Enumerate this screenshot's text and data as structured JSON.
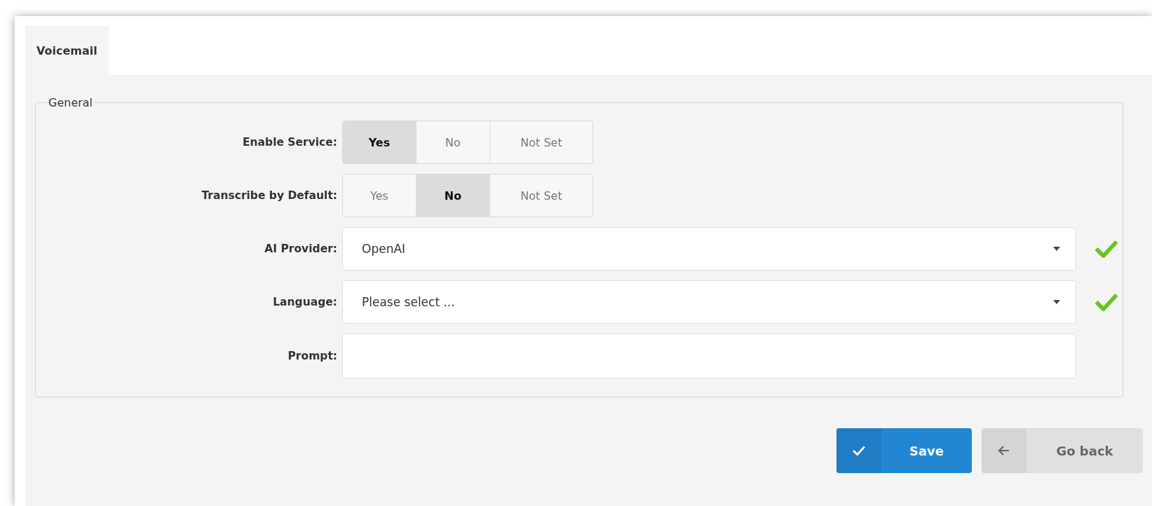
{
  "tabs": [
    {
      "label": "Voicemail",
      "selected": true
    }
  ],
  "fieldset": {
    "legend": "General",
    "fields": [
      {
        "kind": "segmented",
        "label": "Enable Service:",
        "options": [
          {
            "label": "Yes",
            "selected": true
          },
          {
            "label": "No",
            "selected": false
          },
          {
            "label": "Not Set",
            "selected": false
          }
        ]
      },
      {
        "kind": "segmented",
        "label": "Transcribe by Default:",
        "options": [
          {
            "label": "Yes",
            "selected": false
          },
          {
            "label": "No",
            "selected": true
          },
          {
            "label": "Not Set",
            "selected": false
          }
        ]
      },
      {
        "kind": "select",
        "label": "AI Provider:",
        "value": "OpenAI",
        "valid": true
      },
      {
        "kind": "select",
        "label": "Language:",
        "value": "Please select ...",
        "valid": true
      },
      {
        "kind": "text",
        "label": "Prompt:"
      }
    ]
  },
  "buttons": [
    {
      "kind": "primary",
      "label": "Save"
    },
    {
      "kind": "back",
      "label": "Go back"
    }
  ]
}
